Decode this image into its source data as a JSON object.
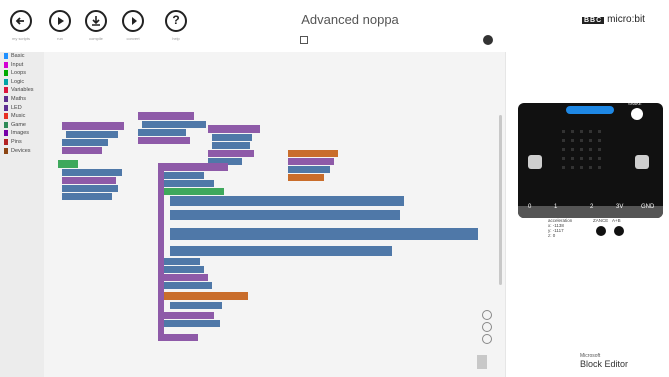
{
  "toolbar": {
    "tools": [
      {
        "name": "back-button",
        "icon": "back-arrow-icon",
        "label": "my scripts"
      },
      {
        "name": "run-button",
        "icon": "play-icon",
        "label": "run"
      },
      {
        "name": "compile-button",
        "icon": "download-icon",
        "label": "compile"
      },
      {
        "name": "convert-button",
        "icon": "lightbulb-play-icon",
        "label": "convert"
      },
      {
        "name": "help-button",
        "icon": "question-icon",
        "label": "help"
      }
    ]
  },
  "document": {
    "title": "Advanced noppa"
  },
  "brand": {
    "bbc": "BBC",
    "name": "micro:bit"
  },
  "categories": [
    {
      "label": "Basic",
      "color": "#1e90ff"
    },
    {
      "label": "Input",
      "color": "#d400d4"
    },
    {
      "label": "Loops",
      "color": "#00aa00"
    },
    {
      "label": "Logic",
      "color": "#00a4a6"
    },
    {
      "label": "Variables",
      "color": "#dc143c"
    },
    {
      "label": "Maths",
      "color": "#5b2d8e"
    },
    {
      "label": "LED",
      "color": "#5c2d91"
    },
    {
      "label": "Music",
      "color": "#e63022"
    },
    {
      "label": "Game",
      "color": "#2e8b57"
    },
    {
      "label": "Images",
      "color": "#7600a8"
    },
    {
      "label": "Pins",
      "color": "#b22222"
    },
    {
      "label": "Devices",
      "color": "#8b4513"
    }
  ],
  "simulator": {
    "shake": "SHAKE",
    "pins": [
      "0",
      "1",
      "2",
      "3V",
      "GND"
    ],
    "accelerometer": [
      "acceleration",
      "x: -1138",
      "y: -1117",
      "z: 0"
    ],
    "pin_buttons": [
      "ZANCE",
      "A+B"
    ]
  },
  "footer": {
    "vendor": "Microsoft",
    "product": "Block Editor"
  },
  "colors": {
    "accent": "#1e88e5",
    "block_blue": "#4f78a8",
    "block_purple": "#8e5aa8",
    "block_orange": "#c96d2b",
    "block_green": "#3ea85c"
  }
}
